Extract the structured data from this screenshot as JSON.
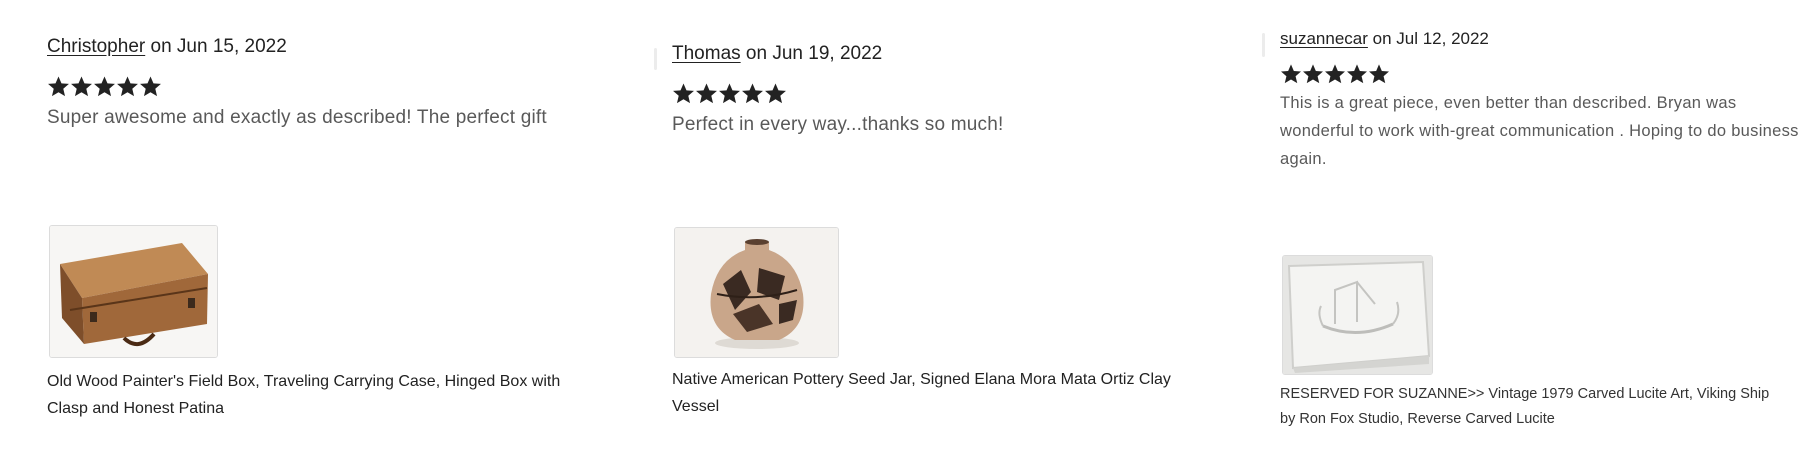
{
  "reviews": [
    {
      "author": "Christopher",
      "date_text": "on Jun 15, 2022",
      "rating": 5,
      "text": "Super awesome and exactly as described! The perfect gift",
      "item_title": "Old Wood Painter's Field Box, Traveling Carrying Case, Hinged Box with Clasp and Honest Patina"
    },
    {
      "author": "Thomas",
      "date_text": "on Jun 19, 2022",
      "rating": 5,
      "text": "Perfect in every way...thanks so much!",
      "item_title": "Native American Pottery Seed Jar, Signed Elana Mora Mata Ortiz Clay Vessel"
    },
    {
      "author": "suzannecar",
      "date_text": "on Jul 12, 2022",
      "rating": 5,
      "text": "This is a great piece, even better than described. Bryan was wonderful to work with-great communication . Hoping to do business again.",
      "item_title": "RESERVED FOR SUZANNE>> Vintage 1979 Carved Lucite Art, Viking Ship by Ron Fox Studio, Reverse Carved Lucite"
    }
  ],
  "colors": {
    "star": "#222222",
    "text_muted": "#595959",
    "text": "#222222"
  }
}
